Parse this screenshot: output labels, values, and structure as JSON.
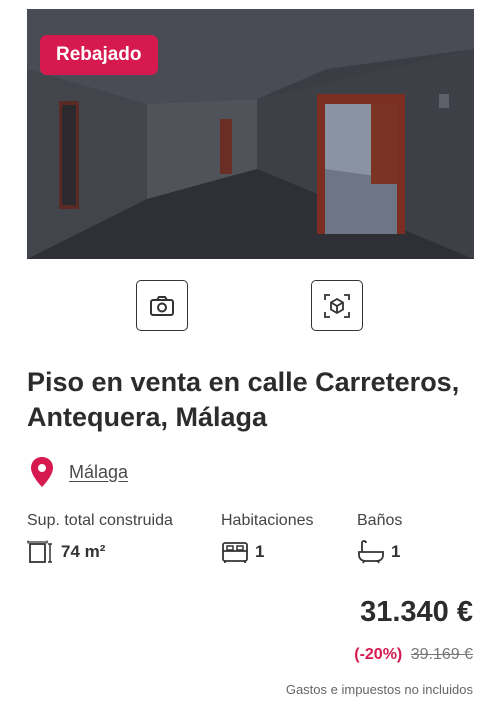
{
  "listing": {
    "badge": "Rebajado",
    "title": "Piso en venta en calle Carreteros, Antequera, Málaga",
    "location": "Málaga",
    "media": {
      "photos_icon": "camera-icon",
      "tour_icon": "virtual-tour-cube-icon"
    },
    "features": {
      "area": {
        "label": "Sup. total construida",
        "value": "74 m²",
        "icon": "area-icon"
      },
      "rooms": {
        "label": "Habitaciones",
        "value": "1",
        "icon": "bed-icon"
      },
      "baths": {
        "label": "Baños",
        "value": "1",
        "icon": "bathtub-icon"
      }
    },
    "price": "31.340 €",
    "discount": "(-20%)",
    "old_price": "39.169 €",
    "taxes_note": "Gastos e impuestos no incluidos"
  },
  "colors": {
    "accent": "#d61a50",
    "text": "#2c2c2c"
  }
}
